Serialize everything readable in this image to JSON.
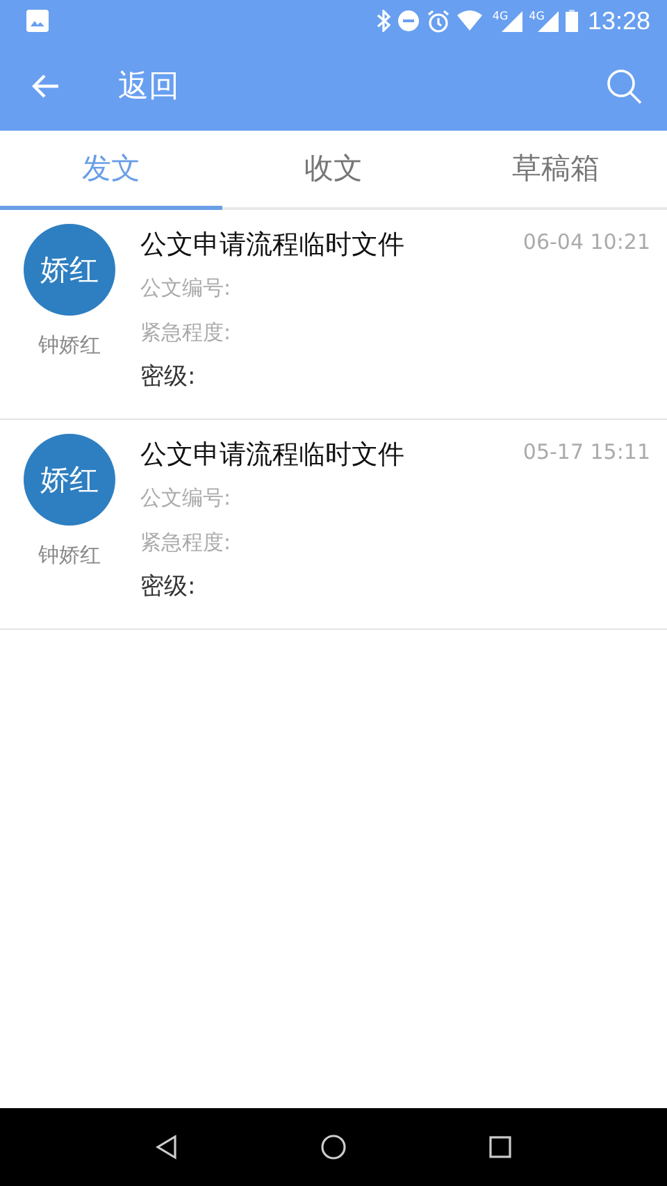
{
  "status_bar": {
    "time": "13:28",
    "signals": [
      {
        "network": "4G"
      },
      {
        "network": "4G"
      }
    ]
  },
  "app_bar": {
    "title": "返回"
  },
  "tabs": [
    {
      "label": "发文",
      "selected": true
    },
    {
      "label": "收文",
      "selected": false
    },
    {
      "label": "草稿箱",
      "selected": false
    }
  ],
  "documents": [
    {
      "avatar": "娇红",
      "sender": "钟娇红",
      "title": "公文申请流程临时文件",
      "time": "06-04 10:21",
      "fields": [
        "公文编号:",
        "紧急程度:"
      ],
      "secrecy": "密级:"
    },
    {
      "avatar": "娇红",
      "sender": "钟娇红",
      "title": "公文申请流程临时文件",
      "time": "05-17 15:11",
      "fields": [
        "公文编号:",
        "紧急程度:"
      ],
      "secrecy": "密级:"
    }
  ]
}
